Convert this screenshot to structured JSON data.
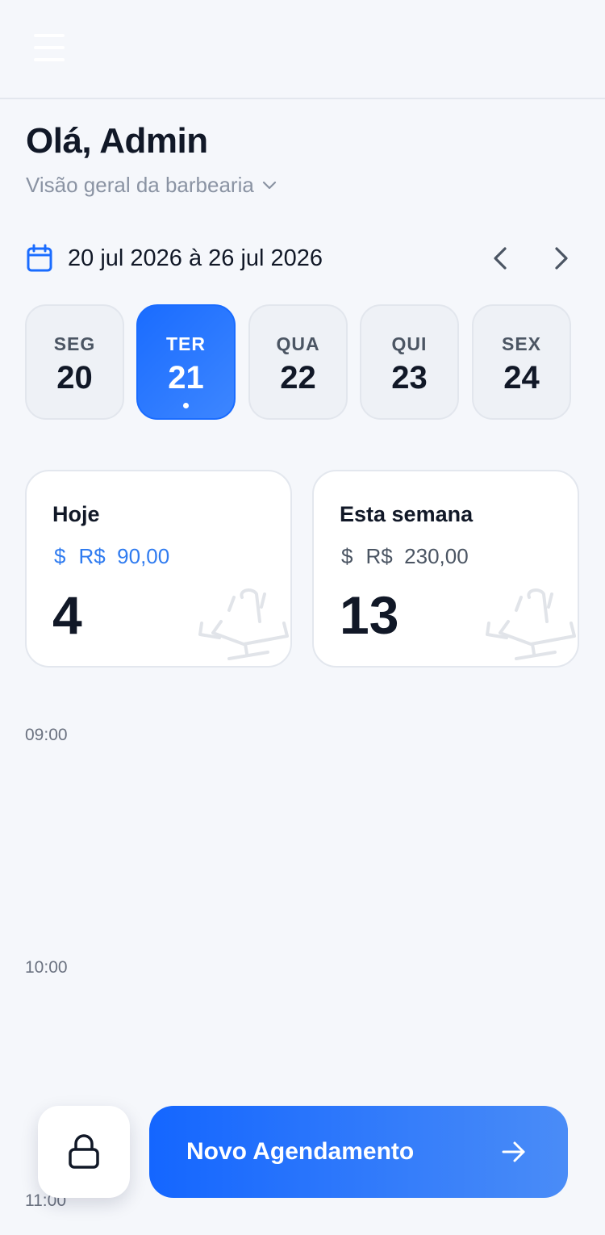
{
  "header": {
    "menu_icon": "hamburger-menu-icon"
  },
  "greeting": "Olá, Admin",
  "subtitle": "Visão geral da barbearia",
  "week": {
    "calendar_icon": "calendar-icon",
    "range": "20 jul 2026 à 26 jul 2026",
    "prev_icon": "chevron-left-icon",
    "next_icon": "chevron-right-icon",
    "days": [
      {
        "name": "SEG",
        "num": "20",
        "selected": false
      },
      {
        "name": "TER",
        "num": "21",
        "selected": true
      },
      {
        "name": "QUA",
        "num": "22",
        "selected": false
      },
      {
        "name": "QUI",
        "num": "23",
        "selected": false
      },
      {
        "name": "SEX",
        "num": "24",
        "selected": false
      }
    ]
  },
  "stats": {
    "today": {
      "title": "Hoje",
      "currency_symbol": "$",
      "amount": "R$  90,00",
      "count": "4"
    },
    "week": {
      "title": "Esta semana",
      "currency_symbol": "$",
      "amount": "R$  230,00",
      "count": "13"
    },
    "decor_icon": "barber-chair-icon"
  },
  "timeline": {
    "slots": [
      "09:00",
      "10:00",
      "11:00"
    ]
  },
  "actions": {
    "lock_icon": "lock-icon",
    "new_appointment_label": "Novo Agendamento",
    "arrow_icon": "arrow-right-icon"
  },
  "colors": {
    "accent": "#1a6cff",
    "accent_light": "#4a8cf7",
    "money_today": "#2f7bf0",
    "background": "#f5f7fb"
  }
}
